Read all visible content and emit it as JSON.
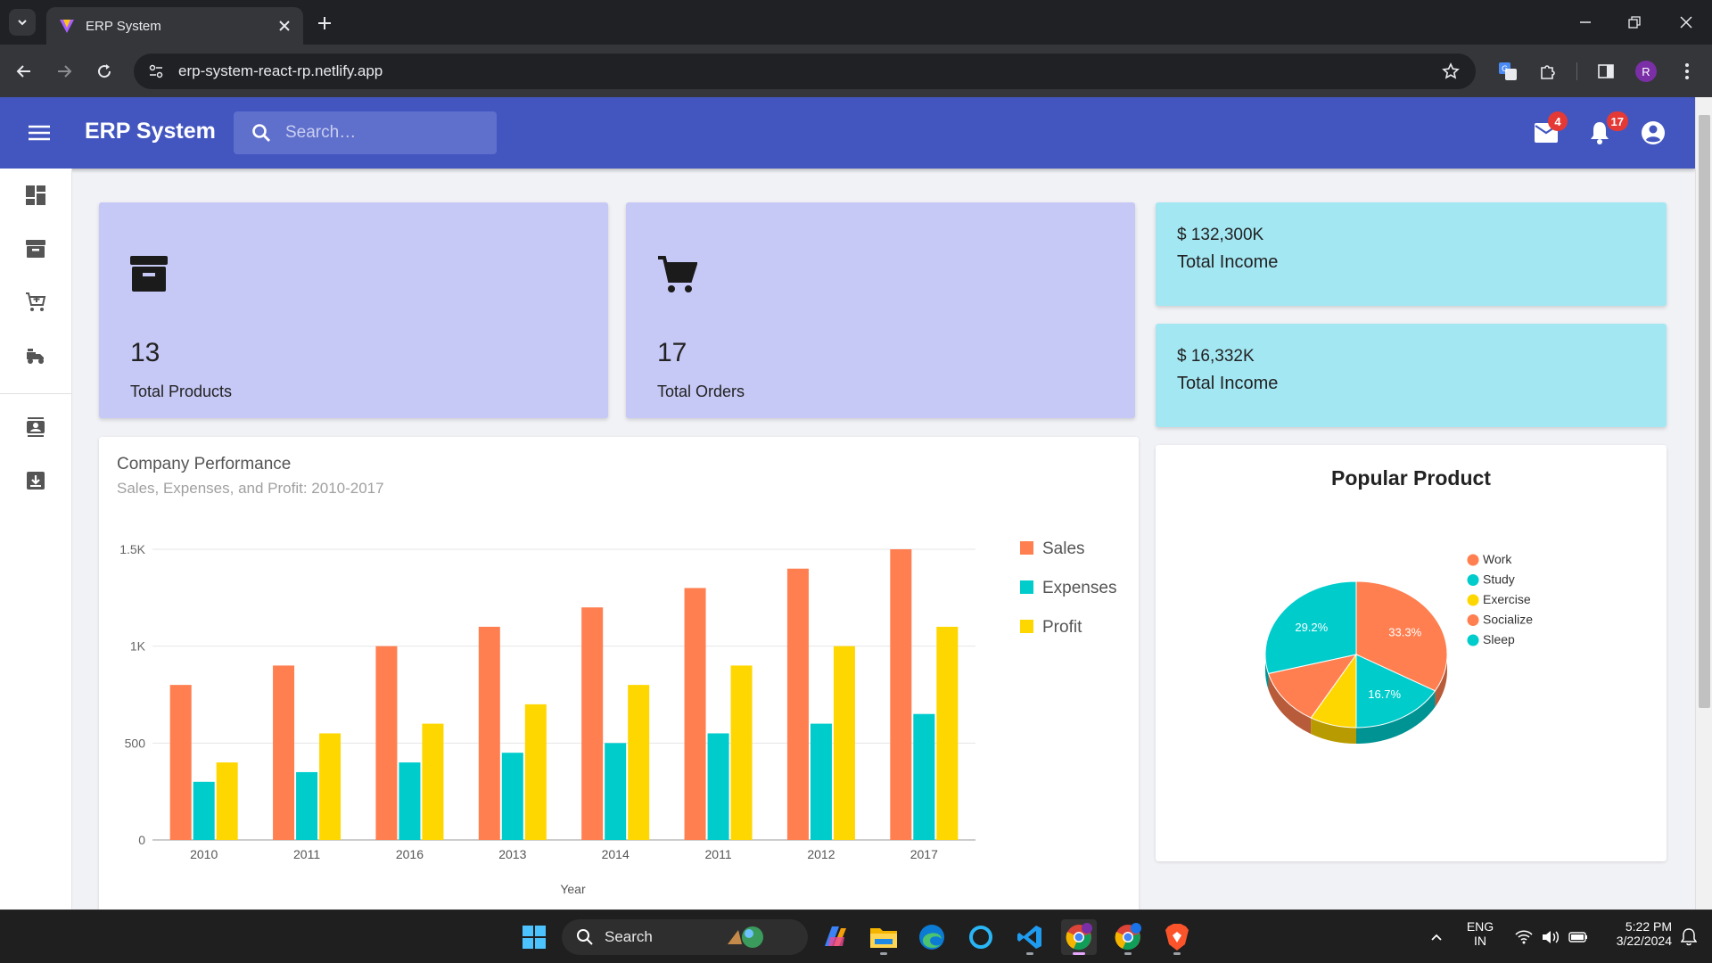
{
  "browser": {
    "tab_title": "ERP System",
    "url": "erp-system-react-rp.netlify.app",
    "profile_initial": "R"
  },
  "app": {
    "title": "ERP System",
    "search_placeholder": "Search…",
    "mail_badge": "4",
    "notifications_badge": "17"
  },
  "sidebar": {
    "items": [
      "dashboard-icon",
      "archive-icon",
      "add-cart-icon",
      "delivery-icon",
      "contacts-icon",
      "download-icon"
    ]
  },
  "stats": [
    {
      "value": "13",
      "label": "Total Products",
      "icon": "archive-icon"
    },
    {
      "value": "17",
      "label": "Total Orders",
      "icon": "cart-icon"
    }
  ],
  "income": [
    {
      "amount": "$ 132,300K",
      "label": "Total Income"
    },
    {
      "amount": "$ 16,332K",
      "label": "Total Income"
    }
  ],
  "performance": {
    "title": "Company Performance",
    "subtitle": "Sales, Expenses, and Profit: 2010-2017"
  },
  "popular": {
    "title": "Popular Product"
  },
  "colors": {
    "primary": "#4356c0",
    "stat_card": "#c6c8f5",
    "income_card": "#a3e7f3",
    "sales": "#ff7f50",
    "expenses": "#00cccc",
    "profit": "#ffd700"
  },
  "chart_data": [
    {
      "type": "bar",
      "title": "Company Performance",
      "subtitle": "Sales, Expenses, and Profit: 2010-2017",
      "xlabel": "Year",
      "ylabel": "",
      "categories": [
        "2010",
        "2011",
        "2016",
        "2013",
        "2014",
        "2011",
        "2012",
        "2017"
      ],
      "series": [
        {
          "name": "Sales",
          "color": "#ff7f50",
          "values": [
            800,
            900,
            1000,
            1100,
            1200,
            1300,
            1400,
            1500
          ]
        },
        {
          "name": "Expenses",
          "color": "#00cccc",
          "values": [
            300,
            350,
            400,
            450,
            500,
            550,
            600,
            650
          ]
        },
        {
          "name": "Profit",
          "color": "#ffd700",
          "values": [
            400,
            550,
            600,
            700,
            800,
            900,
            1000,
            1100
          ]
        }
      ],
      "ylim": [
        0,
        1500
      ],
      "yticks": [
        0,
        500,
        1000,
        1500
      ],
      "ytick_labels": [
        "0",
        "500",
        "1K",
        "1.5K"
      ],
      "grid": true,
      "legend": "right"
    },
    {
      "type": "pie",
      "title": "Popular Product",
      "slices": [
        {
          "label": "Work",
          "value": 33.3,
          "color": "#ff7f50",
          "display": "33.3%"
        },
        {
          "label": "Study",
          "value": 16.7,
          "color": "#00cccc",
          "display": "16.7%"
        },
        {
          "label": "Exercise",
          "value": 8.3,
          "color": "#ffd700",
          "display": ""
        },
        {
          "label": "Socialize",
          "value": 12.5,
          "color": "#ff7f50",
          "display": ""
        },
        {
          "label": "Sleep",
          "value": 29.2,
          "color": "#00cccc",
          "display": "29.2%"
        }
      ],
      "legend": "right",
      "style": "3d"
    }
  ],
  "taskbar": {
    "search_label": "Search",
    "language": "ENG",
    "region": "IN",
    "time": "5:22 PM",
    "date": "3/22/2024",
    "apps": [
      "windows-start-icon",
      "copilot-icon",
      "file-explorer-icon",
      "edge-icon",
      "cortana-icon",
      "vscode-icon",
      "chrome-profile-icon",
      "chrome-icon",
      "brave-icon"
    ]
  }
}
